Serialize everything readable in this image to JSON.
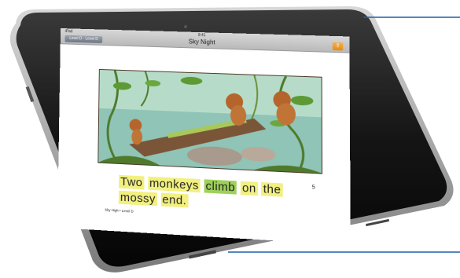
{
  "app": {
    "title": "Sky Night",
    "status_left": "iPad",
    "time": "9:41",
    "back_button": "Level D · Level D",
    "action_icon": "share-icon"
  },
  "page": {
    "text_words": [
      "Two",
      "monkeys",
      "climb",
      "on",
      "the",
      "mossy",
      "end."
    ],
    "highlighted_word": "climb",
    "page_number": "5",
    "footer": "Sky High • Level D"
  },
  "colors": {
    "highlight": "#f2f080",
    "highlight_active": "#9fd15a",
    "device_frame": "#1a1a1a",
    "callout_line": "#1e5fa8"
  }
}
